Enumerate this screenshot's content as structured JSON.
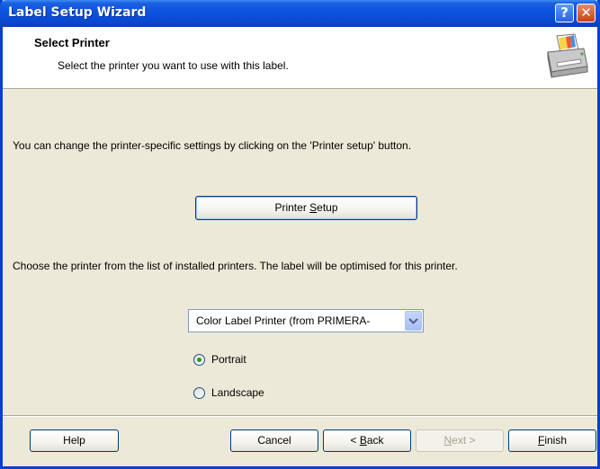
{
  "window": {
    "title": "Label Setup Wizard",
    "help_glyph": "?",
    "close_glyph": "✕"
  },
  "header": {
    "title": "Select Printer",
    "subtitle": "Select the printer you want to use with this label.",
    "icon": "printer-icon"
  },
  "body": {
    "info_text": "You can change the printer-specific settings by clicking on the 'Printer setup' button.",
    "printer_setup_label_pre": "Printer ",
    "printer_setup_label_mnemonic": "S",
    "printer_setup_label_post": "etup",
    "choose_text": "Choose the printer from the list of installed printers. The label will be optimised for this printer.",
    "printer_select_value": "Color Label Printer (from PRIMERA-",
    "orientation": {
      "portrait_label": "Portrait",
      "landscape_label": "Landscape",
      "selected": "Portrait"
    }
  },
  "footer": {
    "help_label": "Help",
    "cancel_label": "Cancel",
    "back_prefix": "< ",
    "back_mnemonic": "B",
    "back_rest": "ack",
    "next_mnemonic": "N",
    "next_rest": "ext >",
    "finish_mnemonic": "F",
    "finish_rest": "inish"
  },
  "colors": {
    "titlebar": "#0a49d2",
    "dialog_bg": "#ece9d8",
    "button_border": "#003c74",
    "radio_dot": "#21a121"
  }
}
